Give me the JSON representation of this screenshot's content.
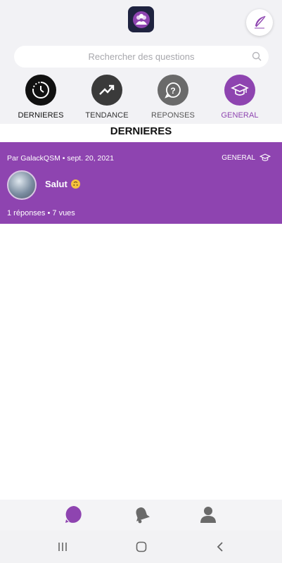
{
  "header": {
    "logo": "app-logo",
    "compose_icon": "quill-icon"
  },
  "search": {
    "placeholder": "Rechercher des questions",
    "icon": "search-icon"
  },
  "categories": [
    {
      "label": "DERNIERES",
      "icon": "clock-icon",
      "color": "#111111"
    },
    {
      "label": "TENDANCE",
      "icon": "trending-icon",
      "color": "#3a3a3a"
    },
    {
      "label": "REPONSES",
      "icon": "question-icon",
      "color": "#6a6a6a"
    },
    {
      "label": "GENERAL",
      "icon": "graduation-cap-icon",
      "color": "#8e44b0",
      "selected": true
    }
  ],
  "section": {
    "title": "DERNIERES"
  },
  "card": {
    "meta": "Par GalackQSM  • sept. 20, 2021",
    "category": "GENERAL",
    "title": "Salut",
    "stats": "1 réponses • 7 vues",
    "color": "#8e44b0"
  },
  "bottom_nav": {
    "items": [
      "chat-icon",
      "bell-icon",
      "profile-icon"
    ],
    "active_color": "#8e44b0"
  },
  "system_nav": {
    "items": [
      "recents-icon",
      "home-icon",
      "back-icon"
    ]
  }
}
